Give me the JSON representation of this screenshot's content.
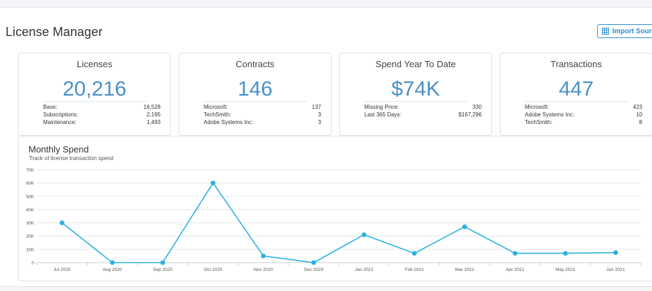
{
  "header": {
    "title": "License Manager",
    "import_label": "Import Sources",
    "import_icon": "grid-import-icon"
  },
  "cards": [
    {
      "title": "Licenses",
      "value": "20,216",
      "rows": [
        {
          "label": "Base:",
          "value": "16,528"
        },
        {
          "label": "Subscriptions:",
          "value": "2,195"
        },
        {
          "label": "Maintenance:",
          "value": "1,493"
        }
      ]
    },
    {
      "title": "Contracts",
      "value": "146",
      "rows": [
        {
          "label": "Microsoft:",
          "value": "137"
        },
        {
          "label": "TechSmith:",
          "value": "3"
        },
        {
          "label": "Adobe Systems Inc:",
          "value": "3"
        }
      ]
    },
    {
      "title": "Spend Year To Date",
      "value": "$74K",
      "rows": [
        {
          "label": "Missing Price:",
          "value": "330"
        },
        {
          "label": "Last 365 Days:",
          "value": "$167,296"
        }
      ]
    },
    {
      "title": "Transactions",
      "value": "447",
      "rows": [
        {
          "label": "Microsoft:",
          "value": "423"
        },
        {
          "label": "Adobe Systems Inc:",
          "value": "10"
        },
        {
          "label": "TechSmith:",
          "value": "8"
        }
      ]
    }
  ],
  "chart": {
    "title": "Monthly Spend",
    "subtitle": "Track of license transaction spend"
  },
  "chart_data": {
    "type": "line",
    "title": "Monthly Spend",
    "subtitle": "Track of license transaction spend",
    "categories": [
      "Jul 2020",
      "Aug 2020",
      "Sep 2020",
      "Oct 2020",
      "Nov 2020",
      "Dec 2020",
      "Jan 2021",
      "Feb 2021",
      "Mar 2021",
      "Apr 2021",
      "May 2021",
      "Jun 2021"
    ],
    "series": [
      {
        "values": [
          30000,
          0,
          0,
          60000,
          5000,
          0,
          21000,
          7000,
          27000,
          7000,
          7000,
          7500
        ]
      }
    ],
    "yticks": [
      "0",
      "10K",
      "20K",
      "30K",
      "40K",
      "50K",
      "60K",
      "70K"
    ],
    "ylim": [
      0,
      70000
    ],
    "grid": true,
    "legend": "none",
    "line_color": "#2cb1e3"
  }
}
